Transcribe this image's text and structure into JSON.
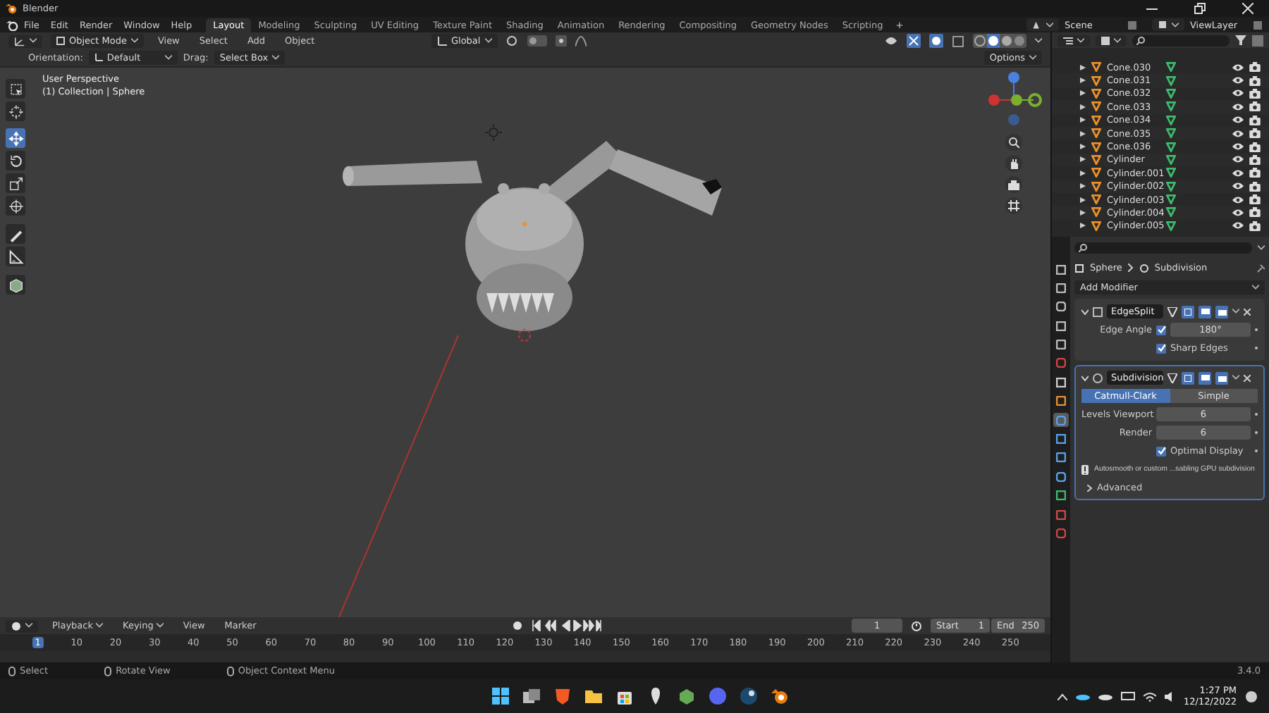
{
  "window": {
    "title": "Blender"
  },
  "menu": [
    "File",
    "Edit",
    "Render",
    "Window",
    "Help"
  ],
  "workspaces": [
    {
      "label": "Layout",
      "selected": true
    },
    {
      "label": "Modeling",
      "selected": false
    },
    {
      "label": "Sculpting",
      "selected": false
    },
    {
      "label": "UV Editing",
      "selected": false
    },
    {
      "label": "Texture Paint",
      "selected": false
    },
    {
      "label": "Shading",
      "selected": false
    },
    {
      "label": "Animation",
      "selected": false
    },
    {
      "label": "Rendering",
      "selected": false
    },
    {
      "label": "Compositing",
      "selected": false
    },
    {
      "label": "Geometry Nodes",
      "selected": false
    },
    {
      "label": "Scripting",
      "selected": false
    }
  ],
  "add_workspace": "+",
  "scene": "Scene",
  "view_layer": "ViewLayer",
  "viewport": {
    "mode": "Object Mode",
    "menus": [
      "View",
      "Select",
      "Add",
      "Object"
    ],
    "transform_orientation": "Global",
    "options": "Options",
    "orientation_label": "Orientation:",
    "orientation": "Default",
    "drag_label": "Drag:",
    "drag": "Select Box",
    "view_name": "User Perspective",
    "context": "(1) Collection | Sphere",
    "tools": [
      {
        "kind": "select",
        "selected": false
      },
      {
        "kind": "cursor",
        "selected": false
      },
      {
        "kind": "move",
        "selected": true
      },
      {
        "kind": "rotate",
        "selected": false
      },
      {
        "kind": "scale",
        "selected": false
      },
      {
        "kind": "transform",
        "selected": false
      },
      {
        "kind": "annotate",
        "selected": false
      },
      {
        "kind": "measure",
        "selected": false
      },
      {
        "kind": "add-cube",
        "selected": false
      }
    ]
  },
  "outliner": {
    "rows": [
      {
        "name": "Cone.030"
      },
      {
        "name": "Cone.031"
      },
      {
        "name": "Cone.032"
      },
      {
        "name": "Cone.033"
      },
      {
        "name": "Cone.034"
      },
      {
        "name": "Cone.035"
      },
      {
        "name": "Cone.036"
      },
      {
        "name": "Cylinder"
      },
      {
        "name": "Cylinder.001"
      },
      {
        "name": "Cylinder.002"
      },
      {
        "name": "Cylinder.003"
      },
      {
        "name": "Cylinder.004"
      },
      {
        "name": "Cylinder.005"
      }
    ]
  },
  "properties": {
    "object": "Sphere",
    "modifier": "Subdivision",
    "add_modifier": "Add Modifier",
    "tabs": [
      {
        "kind": "tool",
        "selected": false
      },
      {
        "kind": "render",
        "selected": false
      },
      {
        "kind": "output",
        "selected": false
      },
      {
        "kind": "view-layer",
        "selected": false
      },
      {
        "kind": "scene",
        "selected": false
      },
      {
        "kind": "world",
        "selected": false
      },
      {
        "kind": "collection",
        "selected": false
      },
      {
        "kind": "object",
        "selected": false
      },
      {
        "kind": "modifier",
        "selected": true
      },
      {
        "kind": "particles",
        "selected": false
      },
      {
        "kind": "physics",
        "selected": false
      },
      {
        "kind": "constraints",
        "selected": false
      },
      {
        "kind": "data",
        "selected": false
      },
      {
        "kind": "material",
        "selected": false
      },
      {
        "kind": "texture",
        "selected": false
      }
    ],
    "modifiers": [
      {
        "kind": "edgesplit",
        "name": "EdgeSplit",
        "expanded": true,
        "active": false,
        "edge_angle_label": "Edge Angle",
        "edge_angle_checked": true,
        "edge_angle": "180°",
        "sharp_edges_label": "Sharp Edges",
        "sharp_edges_checked": true
      },
      {
        "kind": "subdivision",
        "name": "Subdivision",
        "expanded": true,
        "active": true,
        "methods": [
          {
            "label": "Catmull-Clark",
            "selected": true
          },
          {
            "label": "Simple",
            "selected": false
          }
        ],
        "levels_viewport_label": "Levels Viewport",
        "levels_viewport": "6",
        "render_label": "Render",
        "render": "6",
        "optimal_display_label": "Optimal Display",
        "optimal_display_checked": true,
        "warning": "Autosmooth or custom ...sabling GPU subdivision",
        "advanced_label": "Advanced",
        "advanced_expanded": false
      }
    ]
  },
  "timeline": {
    "menus": [
      "Playback",
      "Keying",
      "View",
      "Marker"
    ],
    "current_frame": "1",
    "start_label": "Start",
    "start": "1",
    "end_label": "End",
    "end": "250",
    "ruler": [
      {
        "label": "1",
        "selected": true
      },
      {
        "label": "10",
        "selected": false
      },
      {
        "label": "20",
        "selected": false
      },
      {
        "label": "30",
        "selected": false
      },
      {
        "label": "40",
        "selected": false
      },
      {
        "label": "50",
        "selected": false
      },
      {
        "label": "60",
        "selected": false
      },
      {
        "label": "70",
        "selected": false
      },
      {
        "label": "80",
        "selected": false
      },
      {
        "label": "90",
        "selected": false
      },
      {
        "label": "100",
        "selected": false
      },
      {
        "label": "110",
        "selected": false
      },
      {
        "label": "120",
        "selected": false
      },
      {
        "label": "130",
        "selected": false
      },
      {
        "label": "140",
        "selected": false
      },
      {
        "label": "150",
        "selected": false
      },
      {
        "label": "160",
        "selected": false
      },
      {
        "label": "170",
        "selected": false
      },
      {
        "label": "180",
        "selected": false
      },
      {
        "label": "190",
        "selected": false
      },
      {
        "label": "200",
        "selected": false
      },
      {
        "label": "210",
        "selected": false
      },
      {
        "label": "220",
        "selected": false
      },
      {
        "label": "230",
        "selected": false
      },
      {
        "label": "240",
        "selected": false
      },
      {
        "label": "250",
        "selected": false
      }
    ]
  },
  "status_bar": {
    "hints": [
      "Select",
      "Rotate View",
      "Object Context Menu"
    ],
    "version": "3.4.0"
  },
  "taskbar": {
    "time": "1:27 PM",
    "date": "12/12/2022"
  }
}
